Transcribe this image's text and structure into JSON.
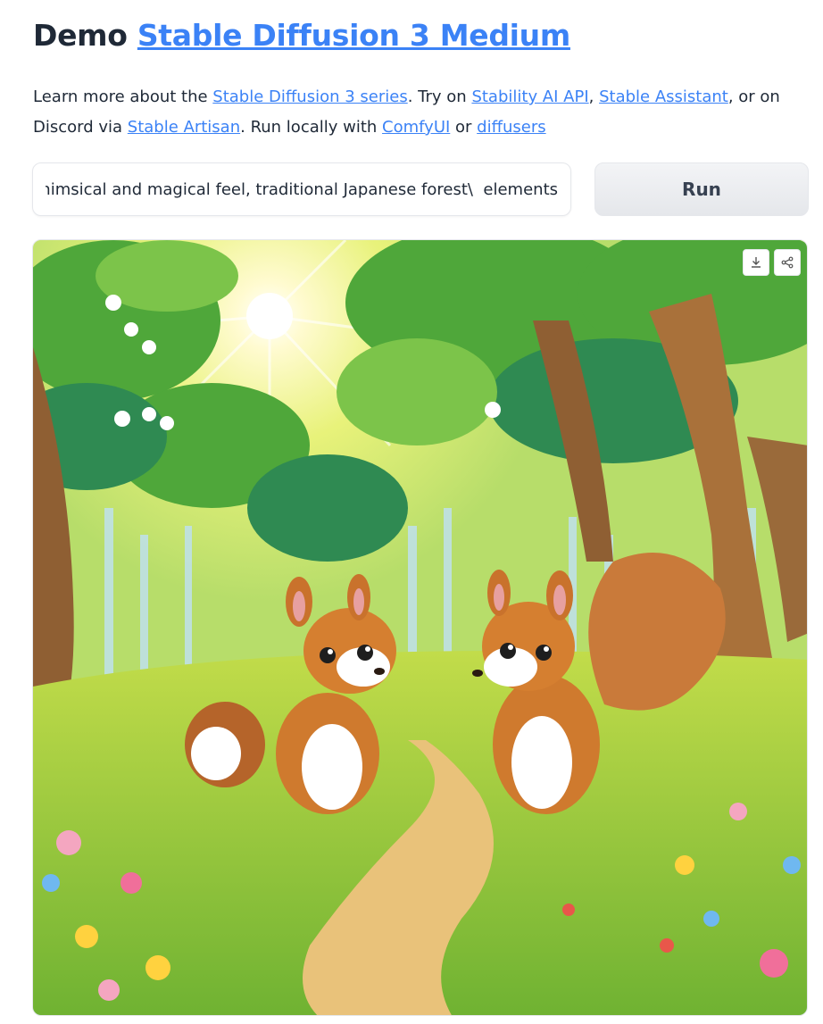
{
  "header": {
    "prefix": "Demo",
    "link_text": "Stable Diffusion 3 Medium"
  },
  "description": {
    "t1": "Learn more about the ",
    "link_series": "Stable Diffusion 3 series",
    "t2": ". Try on ",
    "link_api": "Stability AI API",
    "t3": ", ",
    "link_assistant": "Stable Assistant",
    "t4": ", or on Discord via ",
    "link_artisan": "Stable Artisan",
    "t5": ". Run locally with ",
    "link_comfy": "ComfyUI",
    "t6": " or ",
    "link_diffusers": "diffusers"
  },
  "prompt": {
    "value": "whimsical and magical feel, traditional Japanese forest\\  elements"
  },
  "run_button": {
    "label": "Run"
  },
  "output_image": {
    "subject": "two cartoon squirrels in a sunny forest clearing with flowers",
    "download_icon": "download-icon",
    "share_icon": "share-icon"
  },
  "colors": {
    "link": "#3b82f6",
    "text": "#1f2937",
    "button_bg": "#e5e7eb"
  }
}
